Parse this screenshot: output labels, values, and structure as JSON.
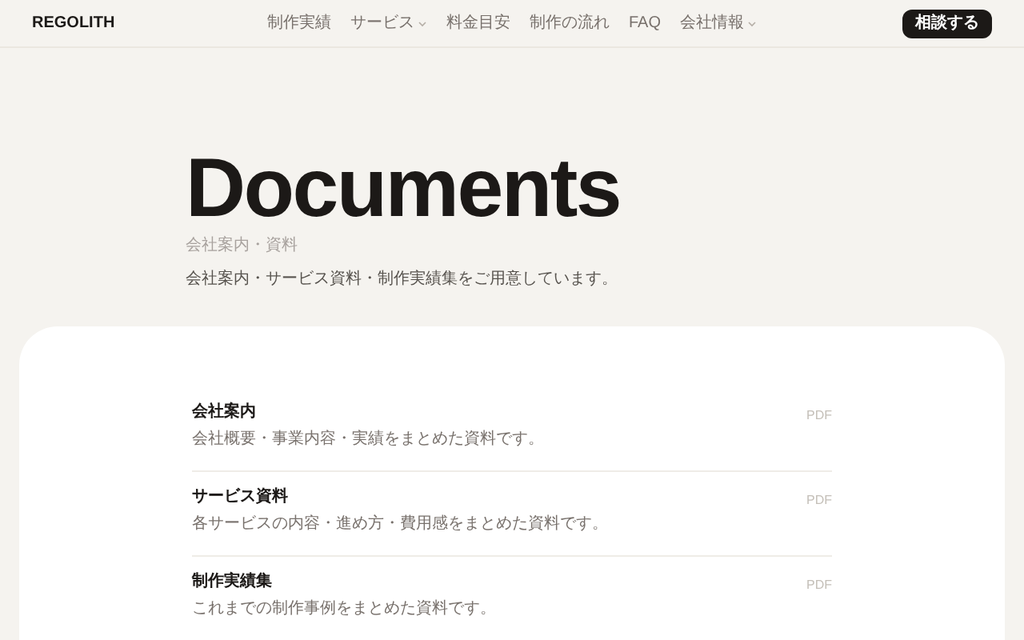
{
  "header": {
    "logo": "REGOLITH",
    "nav": [
      {
        "label": "制作実績",
        "dropdown": false
      },
      {
        "label": "サービス",
        "dropdown": true
      },
      {
        "label": "料金目安",
        "dropdown": false
      },
      {
        "label": "制作の流れ",
        "dropdown": false
      },
      {
        "label": "FAQ",
        "dropdown": false
      },
      {
        "label": "会社情報",
        "dropdown": true
      }
    ],
    "cta": "相談する"
  },
  "hero": {
    "title": "Documents",
    "breadcrumb": "会社案内・資料",
    "description": "会社案内・サービス資料・制作実績集をご用意しています。"
  },
  "documents": [
    {
      "title": "会社案内",
      "description": "会社概要・事業内容・実績をまとめた資料です。",
      "format": "PDF"
    },
    {
      "title": "サービス資料",
      "description": "各サービスの内容・進め方・費用感をまとめた資料です。",
      "format": "PDF"
    },
    {
      "title": "制作実績集",
      "description": "これまでの制作事例をまとめた資料です。",
      "format": "PDF"
    }
  ]
}
